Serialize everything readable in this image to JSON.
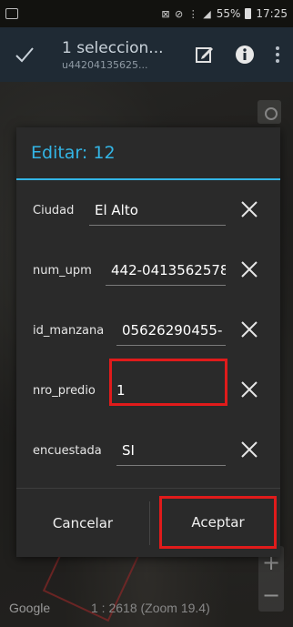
{
  "status_bar": {
    "battery": "55%",
    "time": "17:25"
  },
  "action_bar": {
    "title": "1 seleccion...",
    "subtitle": "u44204135625...",
    "icons": [
      "check-icon",
      "edit-icon",
      "info-icon",
      "overflow-menu-icon"
    ]
  },
  "map": {
    "attribution": "Google",
    "scale_text": "1 : 2618 (Zoom 19.4)",
    "zoom_in_label": "+",
    "zoom_out_label": "−"
  },
  "dialog": {
    "title": "Editar: 12",
    "fields": [
      {
        "label": "Ciudad",
        "value": "El Alto"
      },
      {
        "label": "num_upm",
        "value": "442-0413562578"
      },
      {
        "label": "id_manzana",
        "value": "05626290455-"
      },
      {
        "label": "nro_predio",
        "value": "1"
      },
      {
        "label": "encuestada",
        "value": "SI"
      }
    ],
    "cancel_label": "Cancelar",
    "accept_label": "Aceptar"
  },
  "colors": {
    "accent": "#33b5e5",
    "highlight": "#e01b1b",
    "action_bar": "#1f2a34"
  }
}
